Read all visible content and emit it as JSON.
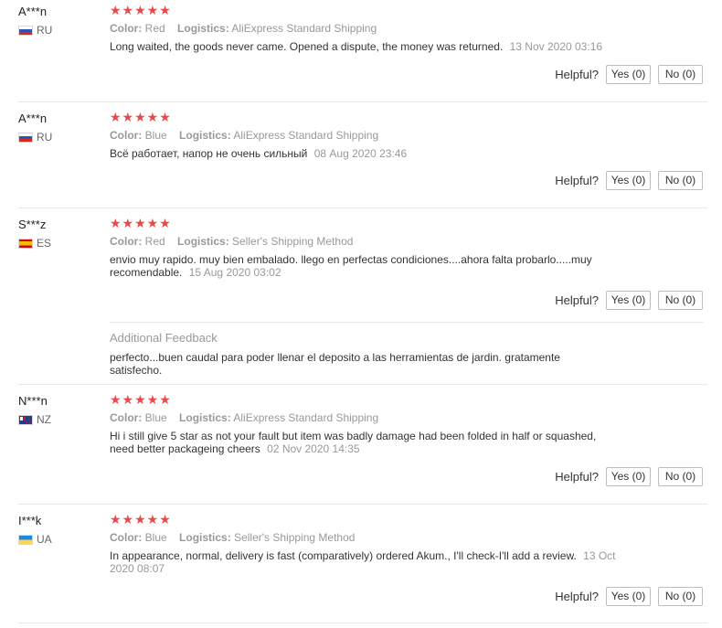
{
  "reviews": [
    {
      "user": "A***n",
      "country_code": "RU",
      "stars": "★★★★★",
      "color_label": "Color:",
      "color_value": "Red",
      "logistics_label": "Logistics:",
      "logistics_value": "AliExpress Standard Shipping",
      "text": "Long waited, the goods never came. Opened a dispute, the money was returned.",
      "date": "13 Nov 2020 03:16",
      "helpful_label": "Helpful?",
      "yes_label": "Yes (0)",
      "no_label": "No (0)"
    },
    {
      "user": "A***n",
      "country_code": "RU",
      "stars": "★★★★★",
      "color_label": "Color:",
      "color_value": "Blue",
      "logistics_label": "Logistics:",
      "logistics_value": "AliExpress Standard Shipping",
      "text": "Всё работает, напор не очень сильный",
      "date": "08 Aug 2020 23:46",
      "helpful_label": "Helpful?",
      "yes_label": "Yes (0)",
      "no_label": "No (0)"
    },
    {
      "user": "S***z",
      "country_code": "ES",
      "stars": "★★★★★",
      "color_label": "Color:",
      "color_value": "Red",
      "logistics_label": "Logistics:",
      "logistics_value": "Seller's Shipping Method",
      "text_line1": "envio muy rapido. muy bien embalado. llego en perfectas condiciones....ahora falta probarlo.....muy",
      "text_line2": "recomendable.",
      "date": "15 Aug 2020 03:02",
      "helpful_label": "Helpful?",
      "yes_label": "Yes (0)",
      "no_label": "No (0)",
      "additional_title": "Additional Feedback",
      "additional_text_line1": "perfecto...buen caudal para poder llenar el deposito a las herramientas de jardin. gratamente",
      "additional_text_line2": "satisfecho."
    },
    {
      "user": "N***n",
      "country_code": "NZ",
      "stars": "★★★★★",
      "color_label": "Color:",
      "color_value": "Blue",
      "logistics_label": "Logistics:",
      "logistics_value": "AliExpress Standard Shipping",
      "text_line1": "Hi i still give 5 star as not your fault but item was badly damage had been folded in half or squashed,",
      "text_line2": "need better packageing cheers",
      "date": "02 Nov 2020 14:35",
      "helpful_label": "Helpful?",
      "yes_label": "Yes (0)",
      "no_label": "No (0)"
    },
    {
      "user": "I***k",
      "country_code": "UA",
      "stars": "★★★★★",
      "color_label": "Color:",
      "color_value": "Blue",
      "logistics_label": "Logistics:",
      "logistics_value": "Seller's Shipping Method",
      "text_line1": "In appearance, normal, delivery is fast (comparatively) ordered Akum., I'll check-I'll add a review.",
      "date_line1": "13 Oct",
      "date_line2": "2020 08:07",
      "helpful_label": "Helpful?",
      "yes_label": "Yes (0)",
      "no_label": "No (0)"
    }
  ],
  "colors": {
    "star_red": "#e8494b",
    "muted_text": "#999999",
    "body_text": "#333333",
    "button_border": "#bdbdbd",
    "divider": "#e8e8e8"
  }
}
